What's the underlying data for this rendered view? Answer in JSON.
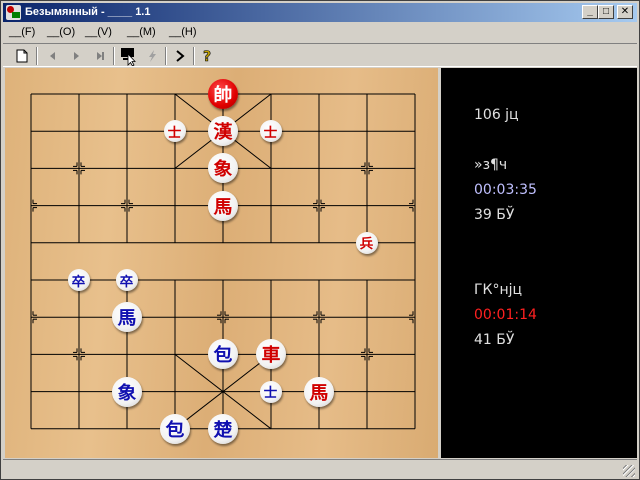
{
  "window": {
    "title": "Безымянный - ____ 1.1",
    "controls": {
      "minimize": "_",
      "maximize": "□",
      "close": "✕"
    }
  },
  "menu": [
    {
      "label": "__(F)"
    },
    {
      "label": "__(O)"
    },
    {
      "label": "__(V)"
    },
    {
      "label": "__(M)"
    },
    {
      "label": "__(H)"
    }
  ],
  "toolbar": {
    "icons": [
      "new-document-icon",
      "first-move-icon",
      "prev-move-icon",
      "next-move-icon",
      "last-move-icon",
      "computer-move-icon",
      "hint-icon",
      "forward-icon",
      "help-icon"
    ]
  },
  "board": {
    "pieces": [
      {
        "text": "帥",
        "side": "red",
        "col": 4,
        "row": 0,
        "type": "general",
        "glyph_hint": ""
      },
      {
        "text": "士",
        "side": "red",
        "col": 3,
        "row": 1,
        "type": "small"
      },
      {
        "text": "漢",
        "side": "red",
        "col": 4,
        "row": 1
      },
      {
        "text": "士",
        "side": "red",
        "col": 5,
        "row": 1,
        "type": "small"
      },
      {
        "text": "象",
        "side": "red",
        "col": 4,
        "row": 2
      },
      {
        "text": "馬",
        "side": "red",
        "col": 4,
        "row": 3
      },
      {
        "text": "兵",
        "side": "red",
        "col": 7,
        "row": 4,
        "type": "small"
      },
      {
        "text": "卒",
        "side": "blue",
        "col": 1,
        "row": 5,
        "type": "small"
      },
      {
        "text": "卒",
        "side": "blue",
        "col": 2,
        "row": 5,
        "type": "small"
      },
      {
        "text": "馬",
        "side": "blue",
        "col": 2,
        "row": 6
      },
      {
        "text": "包",
        "side": "blue",
        "col": 4,
        "row": 7
      },
      {
        "text": "車",
        "side": "red",
        "col": 5,
        "row": 7
      },
      {
        "text": "象",
        "side": "blue",
        "col": 2,
        "row": 8
      },
      {
        "text": "士",
        "side": "blue",
        "col": 5,
        "row": 8,
        "type": "small"
      },
      {
        "text": "馬",
        "side": "red",
        "col": 6,
        "row": 8
      },
      {
        "text": "包",
        "side": "blue",
        "col": 3,
        "row": 9
      },
      {
        "text": "楚",
        "side": "blue",
        "col": 4,
        "row": 9
      }
    ]
  },
  "panel": {
    "move_count": "106 јц",
    "red_label": "»з¶ч",
    "red_time": "00:03:35",
    "red_steps": "39 БЎ",
    "blue_label": "ГК°нјц",
    "blue_time": "00:01:14",
    "blue_steps": "41 БЎ",
    "colors": {
      "default": "#e0e0e0",
      "red_time": "#c0c0ff",
      "blue_time": "#ff2020"
    }
  }
}
